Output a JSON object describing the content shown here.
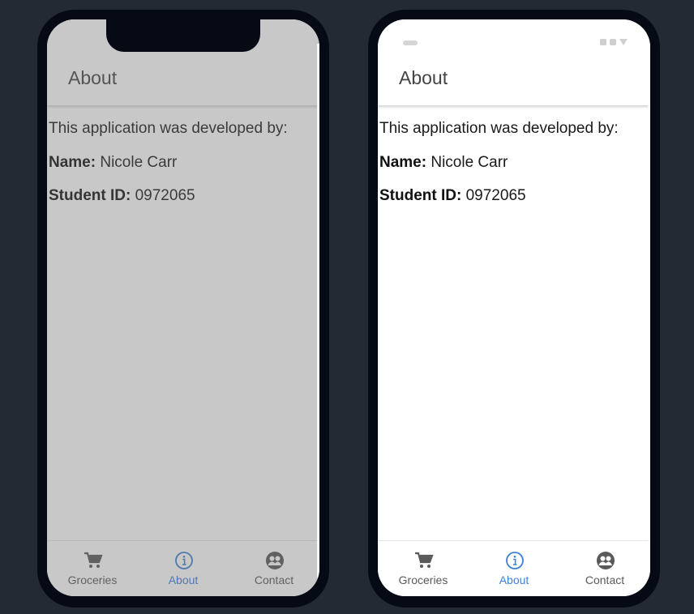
{
  "screen": {
    "header": {
      "title": "About"
    },
    "content": {
      "intro": "This application was developed by:",
      "name_label": "Name:",
      "name_value": "Nicole Carr",
      "student_id_label": "Student ID:",
      "student_id_value": "0972065"
    },
    "tabs": [
      {
        "label": "Groceries",
        "icon": "cart-icon",
        "active": false
      },
      {
        "label": "About",
        "icon": "info-icon",
        "active": true
      },
      {
        "label": "Contact",
        "icon": "people-icon",
        "active": false
      }
    ]
  },
  "colors": {
    "background": "#242a33",
    "phone_frame": "#050a14",
    "accent": "#3d82d8",
    "overlay": "rgba(110,110,110,0.38)"
  }
}
